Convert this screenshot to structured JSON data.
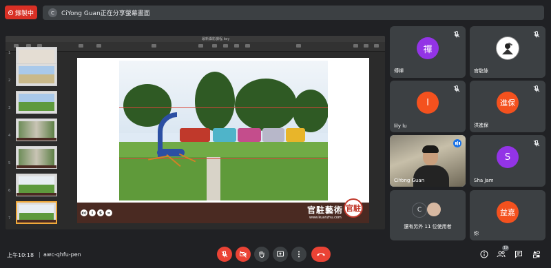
{
  "recording": {
    "label": "錄製中"
  },
  "presenting": {
    "avatar_letter": "C",
    "text": "CiYong Guan正在分享螢幕畫面"
  },
  "keynote": {
    "window_title": "最新攝影課程.key"
  },
  "slide": {
    "brand_text": "官駐藝術",
    "website": "www.kuanzhu.com",
    "seal_text": "官駐",
    "cc_badges": [
      "cc",
      "i",
      "$",
      "="
    ]
  },
  "thumbnails": [
    {
      "num": "1"
    },
    {
      "num": "2"
    },
    {
      "num": "3"
    },
    {
      "num": "4"
    },
    {
      "num": "5"
    },
    {
      "num": "6"
    },
    {
      "num": "7"
    }
  ],
  "participants": [
    {
      "name": "傅禪",
      "avatar": "禪",
      "color": "#9334e6"
    },
    {
      "name": "官駐詠",
      "avatar": "",
      "color": "#ffffff"
    },
    {
      "name": "lily lu",
      "avatar": "l",
      "color": "#f4511e"
    },
    {
      "name": "洪進保",
      "avatar": "進保",
      "color": "#f4511e"
    },
    {
      "name": "CiYong Guan",
      "avatar": "",
      "color": "#000000"
    },
    {
      "name": "Sha Jam",
      "avatar": "S",
      "color": "#9334e6"
    },
    {
      "name": "你",
      "avatar": "益嘉",
      "color": "#f4511e"
    }
  ],
  "others": {
    "avatar_letter": "C",
    "text": "還有另外 11 位使用者"
  },
  "bottom": {
    "time": "上午10:18",
    "separator": "|",
    "meeting_code": "awc-qhfu-pen",
    "people_count": "19"
  }
}
